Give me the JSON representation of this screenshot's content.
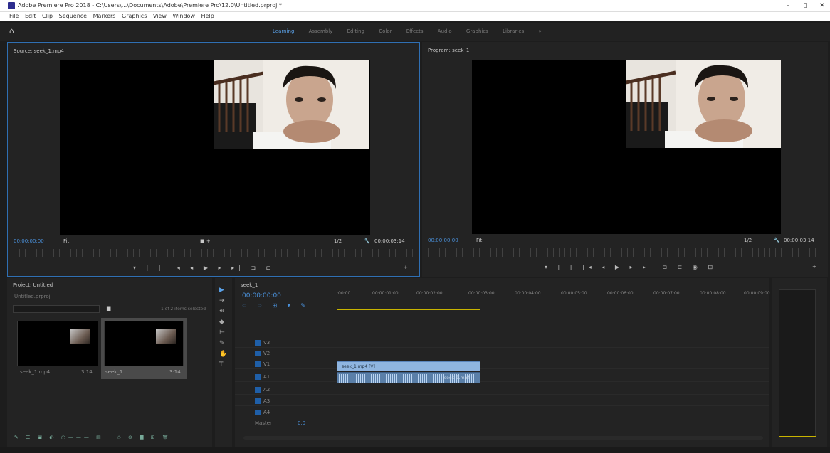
{
  "window": {
    "title": "Adobe Premiere Pro 2018 - C:\\Users\\...\\Documents\\Adobe\\Premiere Pro\\12.0\\Untitled.prproj *",
    "min": "–",
    "max": "▯",
    "close": "✕"
  },
  "menu": [
    "File",
    "Edit",
    "Clip",
    "Sequence",
    "Markers",
    "Graphics",
    "View",
    "Window",
    "Help"
  ],
  "workspaces": [
    "Learning",
    "Assembly",
    "Editing",
    "Color",
    "Effects",
    "Audio",
    "Graphics",
    "Libraries",
    "»"
  ],
  "active_workspace_index": 0,
  "source": {
    "tab": "Source: seek_1.mp4",
    "timecode": "00:00:00:00",
    "fit": "Fit",
    "res": "1/2",
    "duration": "00:00:03:14"
  },
  "program": {
    "tab": "Program: seek_1",
    "timecode": "00:00:00:00",
    "fit": "Fit",
    "res": "1/2",
    "duration": "00:00:03:14"
  },
  "project": {
    "tab": "Project: Untitled",
    "file": "Untitled.prproj",
    "search": "",
    "items_selected": "1 of 2 items selected",
    "items": [
      {
        "name": "seek_1.mp4",
        "duration": "3:14"
      },
      {
        "name": "seek_1",
        "duration": "3:14"
      }
    ]
  },
  "timeline": {
    "tab": "seek_1",
    "timecode": "00:00:00:00",
    "ruler": [
      ":00:00",
      "00:00:01:00",
      "00:00:02:00",
      "00:00:03:00",
      "00:00:04:00",
      "00:00:05:00",
      "00:00:06:00",
      "00:00:07:00",
      "00:00:08:00",
      "00:00:09:00"
    ],
    "tracks": [
      "V3",
      "V2",
      "V1",
      "A1",
      "A2",
      "A3",
      "A4"
    ],
    "master": "Master",
    "master_val": "0.0",
    "clip_v": "seek_1.mp4 [V]",
    "clip_a": "seek_1.mp4"
  },
  "colors": {
    "accent": "#4a90d9",
    "clip_video": "#8fb5e0",
    "clip_audio": "#5a7fa8"
  }
}
